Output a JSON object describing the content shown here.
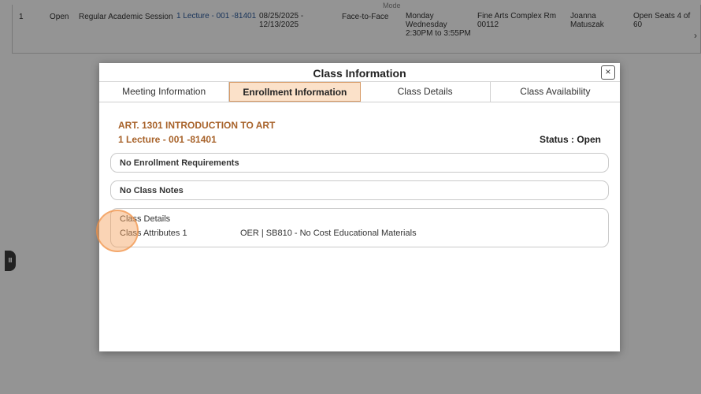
{
  "background_row": {
    "number": "1",
    "status": "Open",
    "session": "Regular Academic Session",
    "section_link": "1 Lecture - 001 -81401",
    "dates_line1": "08/25/2025 -",
    "dates_line2": "12/13/2025",
    "mode": "Face-to-Face",
    "mode_header_cut": "Mode",
    "days_line1": "Monday",
    "days_line2": "Wednesday",
    "time": "2:30PM to 3:55PM",
    "room_line1": "Fine Arts Complex Rm",
    "room_line2": "00112",
    "instructor_line1": "Joanna",
    "instructor_line2": "Matuszak",
    "seats_line1": "Open Seats 4 of",
    "seats_line2": "60",
    "chevron": "›"
  },
  "side_handle": {
    "glyph": "II"
  },
  "modal": {
    "title": "Class Information",
    "close_glyph": "×",
    "tabs": [
      {
        "label": "Meeting Information",
        "active": false
      },
      {
        "label": "Enrollment Information",
        "active": true
      },
      {
        "label": "Class Details",
        "active": false
      },
      {
        "label": "Class Availability",
        "active": false
      }
    ],
    "course_title": "ART. 1301 INTRODUCTION TO ART",
    "section": "1 Lecture - 001 -81401",
    "status": "Status : Open",
    "enrollment_requirements": "No Enrollment Requirements",
    "class_notes": "No Class Notes",
    "class_details": {
      "heading": "Class Details",
      "attribute_label": "Class Attributes 1",
      "attribute_value": "OER | SB810 - No Cost Educational Materials"
    }
  },
  "colors": {
    "accent": "#a8632b",
    "active_tab_bg": "#fbe1c9",
    "link": "#2b5a9b"
  }
}
